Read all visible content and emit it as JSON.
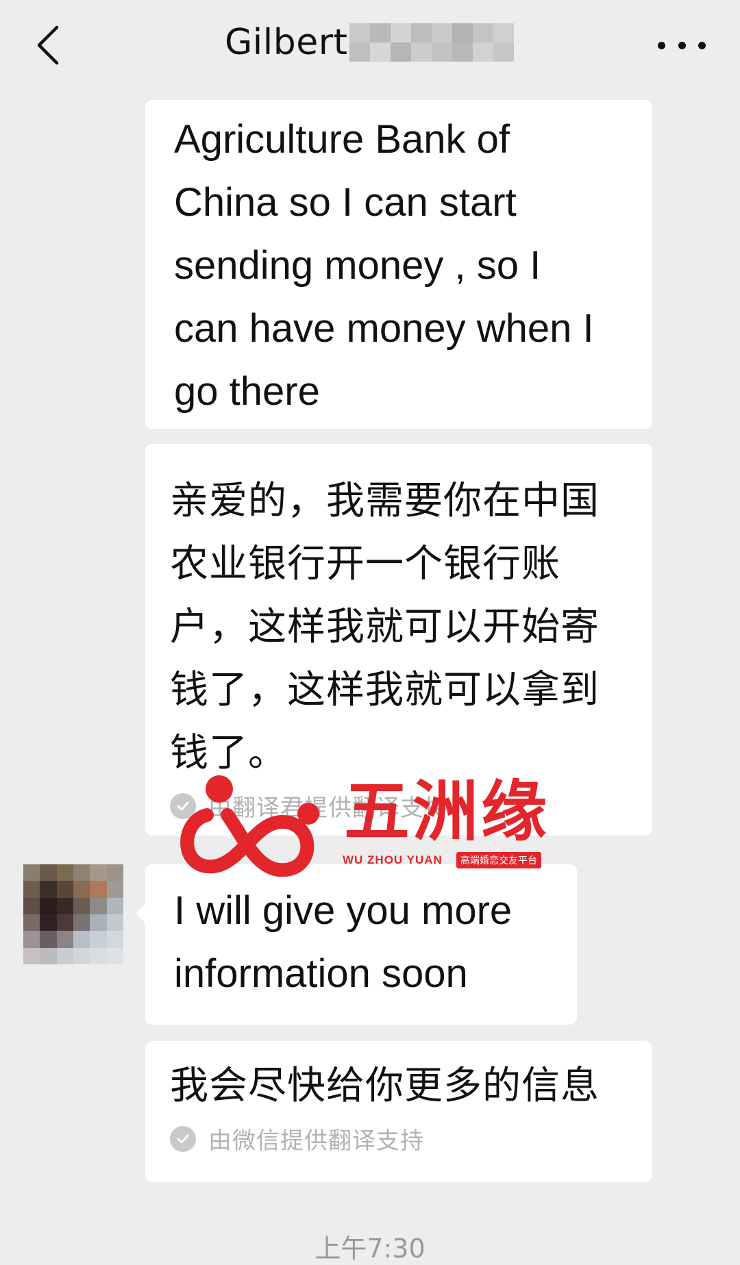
{
  "header": {
    "title": "Gilbert",
    "back_icon": "chevron-left-icon",
    "more_icon": "ellipsis-icon"
  },
  "messages": [
    {
      "sender": "self",
      "text": "Agriculture Bank of\nChina so I can start\nsending money , so I\ncan have money when I\ngo there"
    },
    {
      "sender": "self",
      "text": "亲爱的，我需要你在中国\n农业银行开一个银行账\n户，这样我就可以开始寄\n钱了，这样我就可以拿到\n钱了。",
      "note": "由翻译君提供翻译支持"
    },
    {
      "sender": "contact",
      "text": "I will give you more\ninformation soon"
    },
    {
      "sender": "self",
      "text": "我会尽快给你更多的信息",
      "note": "由微信提供翻译支持"
    }
  ],
  "timestamp": "上午7:30",
  "watermark": {
    "title": "五洲缘",
    "subtitle": "WU ZHOU YUAN",
    "tagline": "高端婚恋交友平台"
  },
  "colors": {
    "background": "#ededed",
    "bubble": "#ffffff",
    "watermark_red": "#e2262b",
    "muted_text": "#b2b2b2"
  }
}
